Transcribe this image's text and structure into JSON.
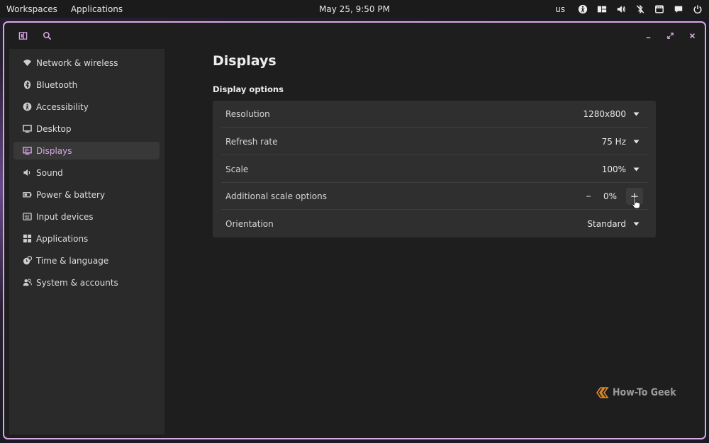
{
  "panel": {
    "workspaces": "Workspaces",
    "applications": "Applications",
    "clock": "May 25, 9:50 PM",
    "keyboard_layout": "us"
  },
  "icons": {
    "sidebar_toggle": "sidebar-toggle-icon",
    "search": "search-icon",
    "minimize": "minimize-icon",
    "maximize": "maximize-icon",
    "close": "close-icon"
  },
  "sidebar": {
    "items": [
      {
        "label": "Network & wireless",
        "icon": "wifi-icon"
      },
      {
        "label": "Bluetooth",
        "icon": "bluetooth-icon"
      },
      {
        "label": "Accessibility",
        "icon": "accessibility-icon"
      },
      {
        "label": "Desktop",
        "icon": "desktop-icon"
      },
      {
        "label": "Displays",
        "icon": "display-icon",
        "active": true
      },
      {
        "label": "Sound",
        "icon": "speaker-icon"
      },
      {
        "label": "Power & battery",
        "icon": "battery-icon"
      },
      {
        "label": "Input devices",
        "icon": "keyboard-icon"
      },
      {
        "label": "Applications",
        "icon": "apps-grid-icon"
      },
      {
        "label": "Time & language",
        "icon": "time-language-icon"
      },
      {
        "label": "System & accounts",
        "icon": "users-icon"
      }
    ]
  },
  "main": {
    "title": "Displays",
    "section_title": "Display options",
    "rows": {
      "resolution": {
        "label": "Resolution",
        "value": "1280x800"
      },
      "refresh_rate": {
        "label": "Refresh rate",
        "value": "75 Hz"
      },
      "scale": {
        "label": "Scale",
        "value": "100%"
      },
      "additional_scale": {
        "label": "Additional scale options",
        "value": "0%",
        "minus": "–",
        "plus": "+"
      },
      "orientation": {
        "label": "Orientation",
        "value": "Standard"
      }
    }
  },
  "watermark": {
    "text": "How-To Geek"
  },
  "colors": {
    "accent": "#d9a6e6",
    "window_bg": "#1e1e1e",
    "sidebar_bg": "#2a2a2a",
    "card_bg": "#2f2f2f",
    "panel_bg": "#1b1b1b",
    "watermark": "#e08a2a"
  }
}
